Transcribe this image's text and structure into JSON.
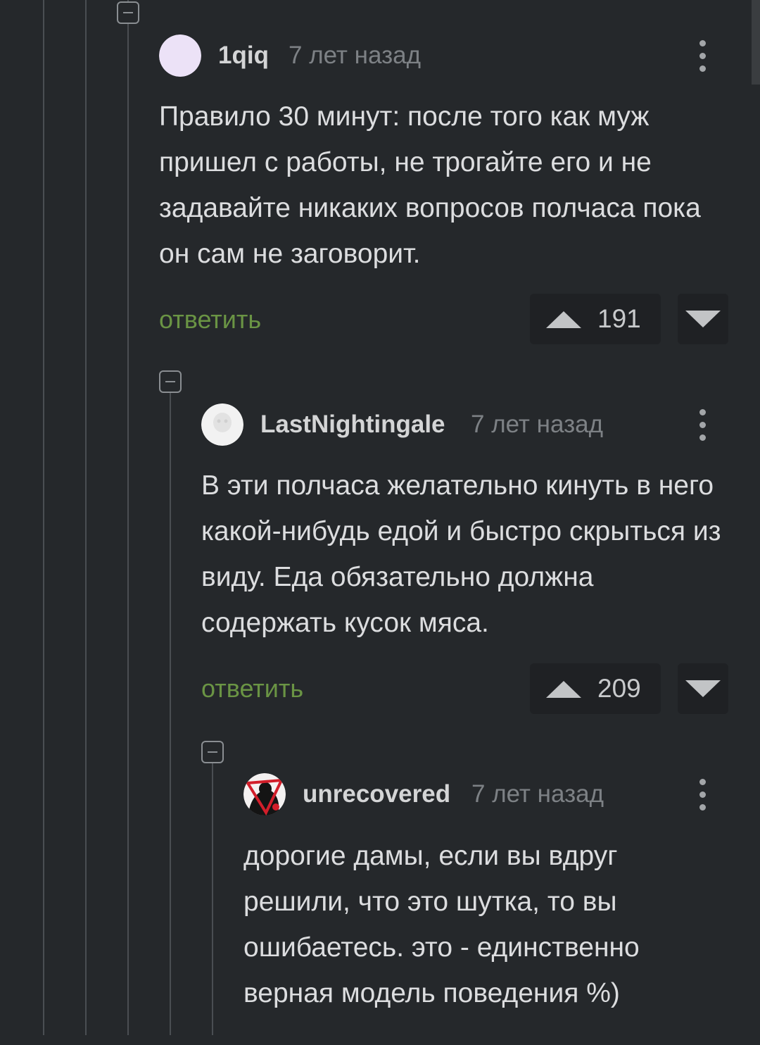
{
  "comments": [
    {
      "username": "1qiq",
      "time": "7 лет назад",
      "text": "Правило 30 минут: после того как муж пришел с работы, не трогайте его и не задавайте никаких вопросов полчаса пока он сам не заговорит.",
      "reply_label": "ответить",
      "votes": "191",
      "avatar": "lavender-circle-avatar"
    },
    {
      "username": "LastNightingale",
      "time": "7 лет назад",
      "text": "В эти полчаса желательно кинуть в него какой-нибудь едой и быстро скрыться из виду. Еда обязательно должна содержать кусок мяса.",
      "reply_label": "ответить",
      "votes": "209",
      "avatar": "white-ghost-avatar"
    },
    {
      "username": "unrecovered",
      "time": "7 лет назад",
      "text": "дорогие дамы, если вы вдруг решили, что это шутка, то вы ошибаетесь. это - единственно верная модель поведения %)",
      "avatar": "red-silhouette-avatar"
    }
  ],
  "colors": {
    "background": "#25282b",
    "reply_link": "#6a9444",
    "vote_box": "#1f2124",
    "thread_line": "#4a4e52"
  }
}
